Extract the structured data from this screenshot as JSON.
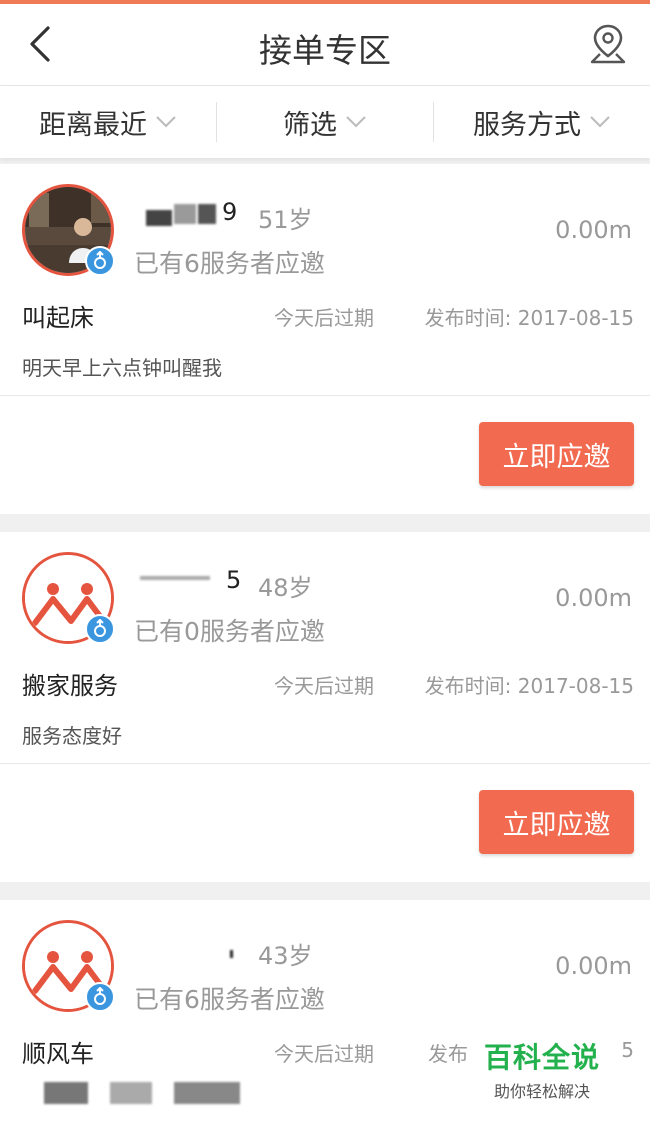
{
  "header": {
    "title": "接单专区"
  },
  "filters": [
    {
      "label": "距离最近"
    },
    {
      "label": "筛选"
    },
    {
      "label": "服务方式"
    }
  ],
  "orders": [
    {
      "name_fragment": "9",
      "age": "51岁",
      "invited": "已有6服务者应邀",
      "distance": "0.00m",
      "service": "叫起床",
      "expire": "今天后过期",
      "published": "发布时间: 2017-08-15",
      "desc": "明天早上六点钟叫醒我",
      "action": "立即应邀"
    },
    {
      "name_fragment": "5",
      "age": "48岁",
      "invited": "已有0服务者应邀",
      "distance": "0.00m",
      "service": "搬家服务",
      "expire": "今天后过期",
      "published": "发布时间: 2017-08-15",
      "desc": "服务态度好",
      "action": "立即应邀"
    },
    {
      "name_fragment": "",
      "age": "43岁",
      "invited": "已有6服务者应邀",
      "distance": "0.00m",
      "service": "顺风车",
      "expire": "今天后过期",
      "published": "发布",
      "published_tail": "5"
    }
  ],
  "watermark": {
    "title": "百科全说",
    "subtitle": "助你轻松解决"
  },
  "colors": {
    "accent": "#f26a4f",
    "gender_badge": "#3b96e0",
    "avatar_ring": "#e5543f",
    "watermark": "#22b14c"
  }
}
